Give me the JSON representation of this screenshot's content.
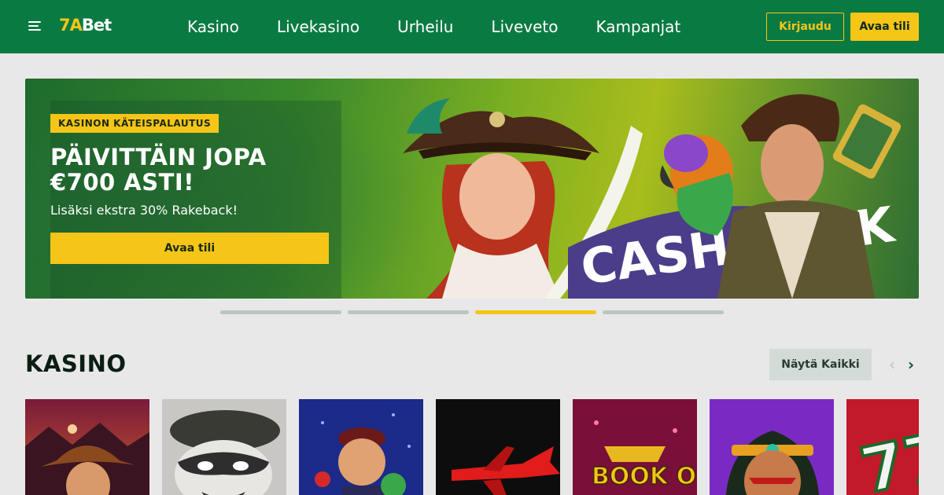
{
  "header": {
    "logo": {
      "num": "7A",
      "text": "Bet"
    },
    "nav": [
      "Kasino",
      "Livekasino",
      "Urheilu",
      "Liveveto",
      "Kampanjat"
    ],
    "login_label": "Kirjaudu",
    "open_account_label": "Avaa tili"
  },
  "banner": {
    "tag": "KASINON KÄTEISPALAUTUS",
    "title": "PÄIVITTÄIN JOPA €700 ASTI!",
    "subtitle": "Lisäksi ekstra 30% Rakeback!",
    "cta": "Avaa tili",
    "art_text": "CASH BACK",
    "slides": 4,
    "active_slide": 3
  },
  "section": {
    "title": "KASINO",
    "show_all": "Näytä Kaikki"
  },
  "games": [
    {
      "icon": "cowboy-explorer"
    },
    {
      "icon": "raccoon-bandit"
    },
    {
      "icon": "mobster-character"
    },
    {
      "icon": "red-airplane"
    },
    {
      "icon": "book-of-logo",
      "text": "BOOK OF"
    },
    {
      "icon": "aztec-warrior"
    },
    {
      "icon": "lucky-sevens"
    }
  ],
  "colors": {
    "brand_green": "#0a7a43",
    "accent_yellow": "#f5c518",
    "page_bg": "#e8e8e8"
  }
}
